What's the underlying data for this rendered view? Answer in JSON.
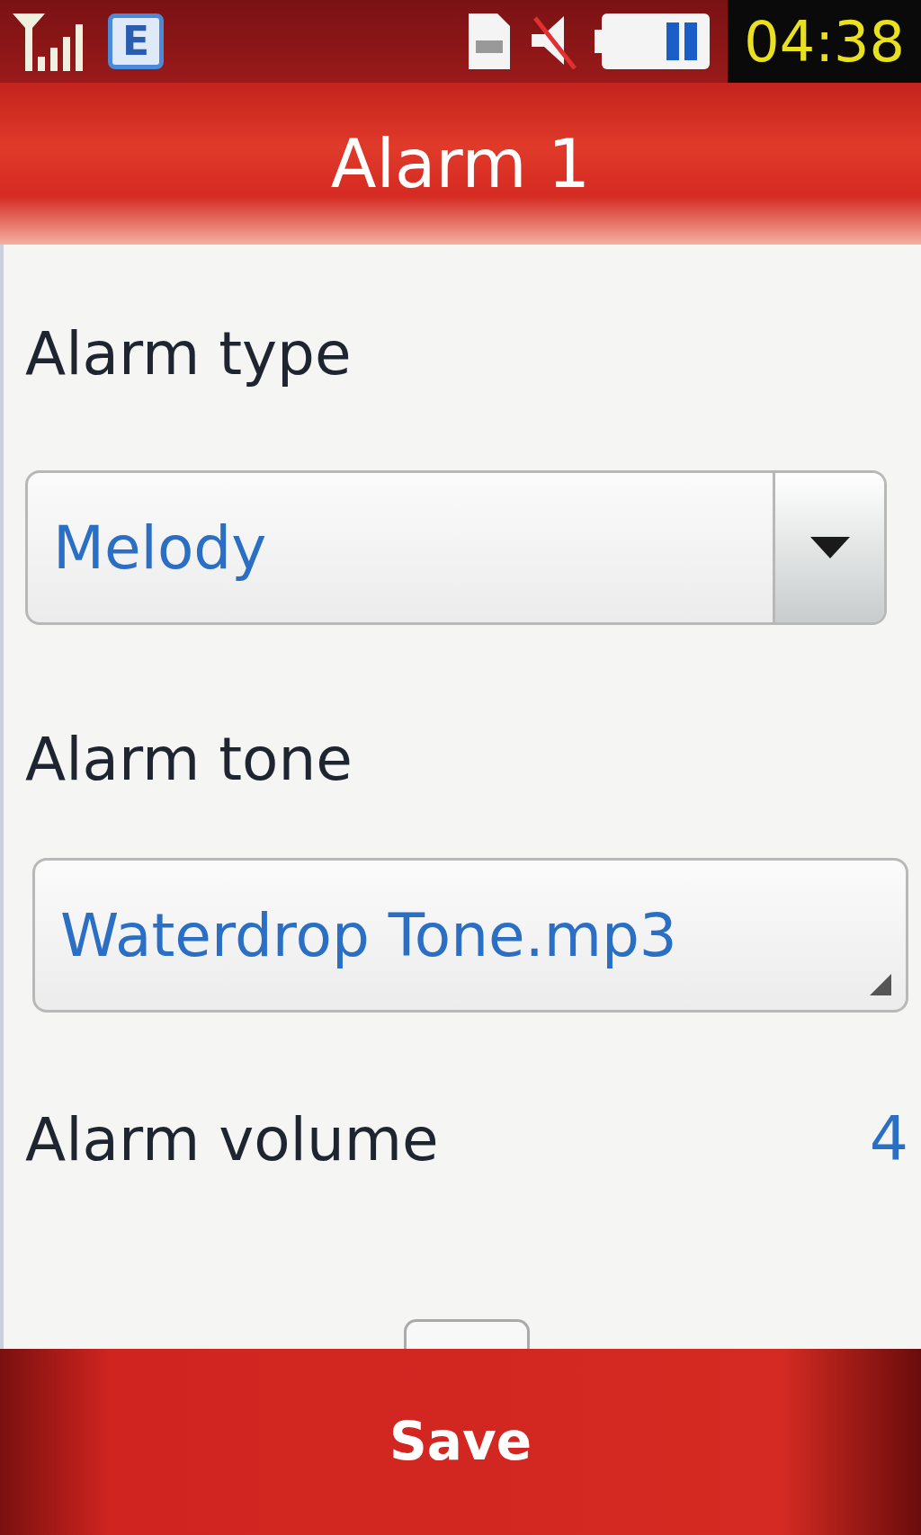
{
  "status_bar": {
    "network_type": "E",
    "muted": true,
    "time": "04:38"
  },
  "title": "Alarm 1",
  "fields": [
    {
      "kind": "dropdown",
      "label": "Alarm type",
      "value": "Melody"
    },
    {
      "kind": "picker",
      "label": "Alarm tone",
      "value": "Waterdrop Tone.mp3"
    },
    {
      "kind": "slider",
      "label": "Alarm volume",
      "reading": "4"
    }
  ],
  "softkeys": [
    "Save"
  ]
}
